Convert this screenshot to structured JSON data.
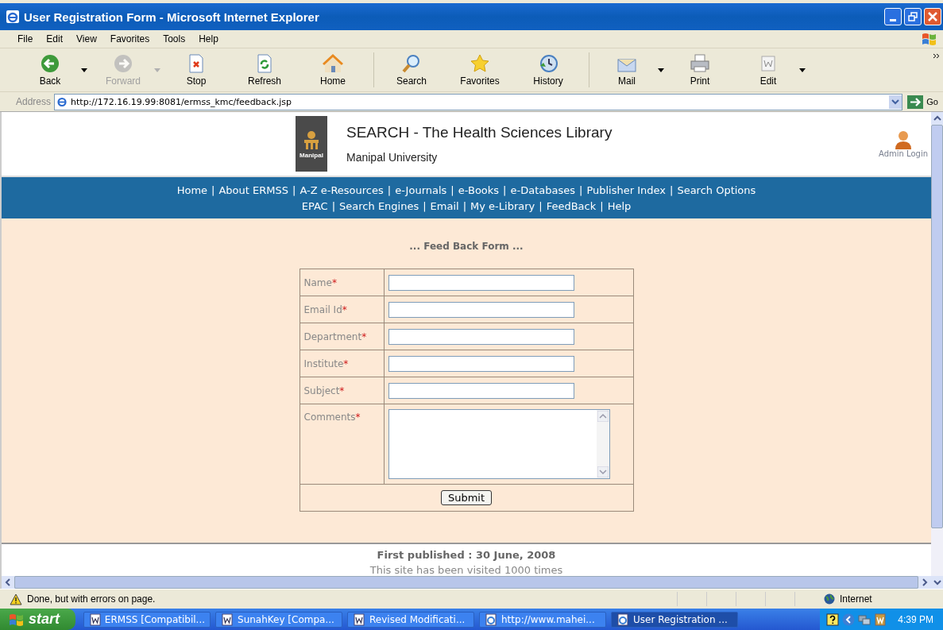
{
  "window": {
    "title": "User Registration Form - Microsoft Internet Explorer"
  },
  "menu": [
    "File",
    "Edit",
    "View",
    "Favorites",
    "Tools",
    "Help"
  ],
  "toolbar": [
    {
      "label": "Back",
      "kind": "back",
      "disabled": false,
      "dropdown": true
    },
    {
      "label": "Forward",
      "kind": "forward",
      "disabled": true,
      "dropdown": true
    },
    {
      "label": "Stop",
      "kind": "stop",
      "disabled": false,
      "dropdown": false
    },
    {
      "label": "Refresh",
      "kind": "refresh",
      "disabled": false,
      "dropdown": false
    },
    {
      "label": "Home",
      "kind": "home",
      "disabled": false,
      "dropdown": false
    },
    {
      "label": "Search",
      "kind": "search",
      "disabled": false,
      "dropdown": false
    },
    {
      "label": "Favorites",
      "kind": "favorites",
      "disabled": false,
      "dropdown": false
    },
    {
      "label": "History",
      "kind": "history",
      "disabled": false,
      "dropdown": false
    },
    {
      "label": "Mail",
      "kind": "mail",
      "disabled": false,
      "dropdown": true
    },
    {
      "label": "Print",
      "kind": "print",
      "disabled": false,
      "dropdown": false
    },
    {
      "label": "Edit",
      "kind": "edit",
      "disabled": false,
      "dropdown": true
    }
  ],
  "address_bar": {
    "label": "Address",
    "url": "http://172.16.19.99:8081/ermss_kmc/feedback.jsp",
    "go": "Go"
  },
  "page": {
    "logo_text": "Manipal",
    "title": "SEARCH - The Health Sciences Library",
    "subtitle": "Manipal University",
    "admin_login": "Admin Login",
    "nav_rows": [
      [
        "Home",
        "About ERMSS",
        "A-Z e-Resources",
        "e-Journals",
        "e-Books",
        "e-Databases",
        "Publisher Index",
        "Search Options"
      ],
      [
        "EPAC",
        "Search Engines",
        "Email",
        "My e-Library",
        "FeedBack",
        "Help"
      ]
    ],
    "separator": "|",
    "form_title": "... Feed Back Form ...",
    "fields": [
      {
        "label": "Name",
        "required_mark": "*",
        "kind": "text"
      },
      {
        "label": "Email Id",
        "required_mark": "*",
        "kind": "text"
      },
      {
        "label": "Department",
        "required_mark": "*",
        "kind": "text"
      },
      {
        "label": "Institute",
        "required_mark": "*",
        "kind": "text"
      },
      {
        "label": "Subject",
        "required_mark": "*",
        "kind": "text"
      },
      {
        "label": "Comments",
        "required_mark": "*",
        "kind": "textarea"
      }
    ],
    "submit": "Submit",
    "footer": [
      "First published : 30 June, 2008",
      "This site has been visited  1000 times"
    ]
  },
  "status_bar": {
    "text": "Done, but with errors on page.",
    "zone": "Internet"
  },
  "taskbar": {
    "start": "start",
    "tasks": [
      {
        "label": "ERMSS [Compatibil...",
        "kind": "word",
        "selected": false
      },
      {
        "label": "SunahKey [Compa...",
        "kind": "word",
        "selected": false
      },
      {
        "label": "Revised Modificati...",
        "kind": "word",
        "selected": false
      },
      {
        "label": "http://www.mahei...",
        "kind": "ie",
        "selected": false
      },
      {
        "label": "User Registration ...",
        "kind": "ie",
        "selected": true
      }
    ],
    "clock": "4:39 PM"
  }
}
